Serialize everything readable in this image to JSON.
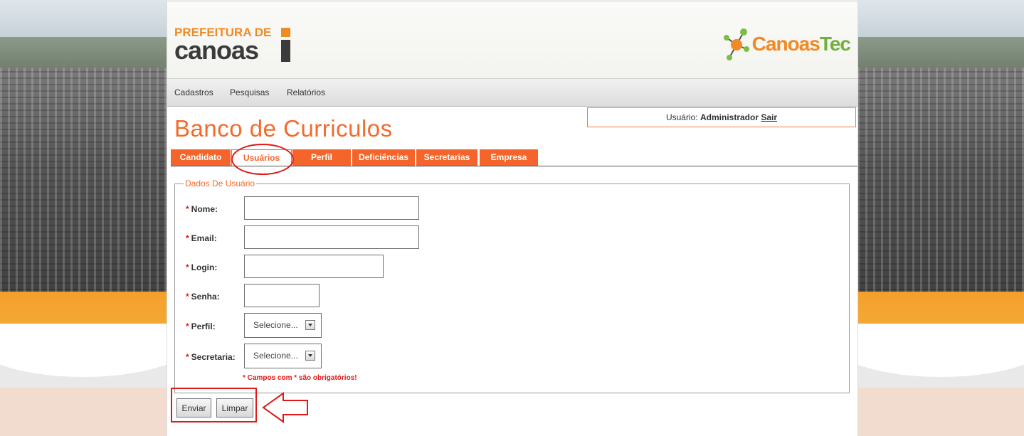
{
  "logos": {
    "prefeitura_line1": "PREFEITURA DE",
    "prefeitura_line2": "canoas",
    "canoastec_part1": "Canoas",
    "canoastec_part2": "Tec"
  },
  "menu": {
    "items": [
      {
        "label": "Cadastros"
      },
      {
        "label": "Pesquisas"
      },
      {
        "label": "Relatórios"
      }
    ]
  },
  "user": {
    "prefix": "Usuário:",
    "name": "Administrador",
    "logout": "Sair"
  },
  "page": {
    "title": "Banco de Curriculos"
  },
  "tabs": [
    {
      "label": "Candidato",
      "active": false
    },
    {
      "label": "Usuários",
      "active": true
    },
    {
      "label": "Perfil",
      "active": false
    },
    {
      "label": "Deficiências",
      "active": false
    },
    {
      "label": "Secretarias",
      "active": false
    },
    {
      "label": "Empresa",
      "active": false
    }
  ],
  "form": {
    "legend": "Dados De Usuário",
    "required_mark": "*",
    "fields": {
      "nome": {
        "label": "Nome:",
        "value": ""
      },
      "email": {
        "label": "Email:",
        "value": ""
      },
      "login": {
        "label": "Login:",
        "value": ""
      },
      "senha": {
        "label": "Senha:",
        "value": ""
      },
      "perfil": {
        "label": "Perfil:",
        "selected": "Selecione..."
      },
      "secretaria": {
        "label": "Secretaria:",
        "selected": "Selecione..."
      }
    },
    "required_note": "* Campos com * são obrigatórios!",
    "buttons": {
      "submit": "Enviar",
      "clear": "Limpar"
    }
  },
  "colors": {
    "accent": "#f5642a",
    "annotation": "#e01919"
  }
}
